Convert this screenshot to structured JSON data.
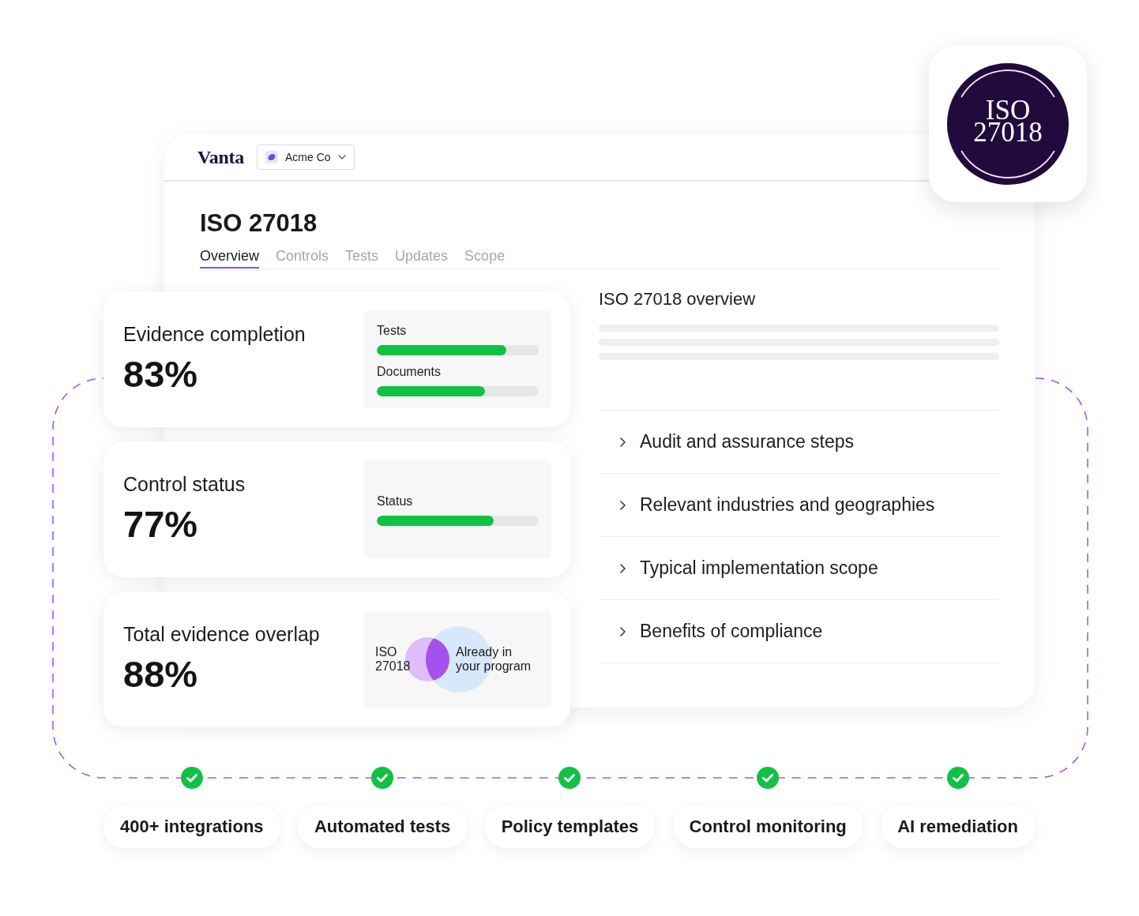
{
  "header": {
    "logo": "Vanta",
    "workspace": "Acme Co"
  },
  "badge": {
    "text": "ISO 27018"
  },
  "page": {
    "title": "ISO 27018",
    "tabs": [
      {
        "label": "Overview",
        "selected": true
      },
      {
        "label": "Controls",
        "selected": false
      },
      {
        "label": "Tests",
        "selected": false
      },
      {
        "label": "Updates",
        "selected": false
      },
      {
        "label": "Scope",
        "selected": false
      }
    ]
  },
  "cards": [
    {
      "kind": "bars",
      "title": "Evidence completion",
      "value": "83%",
      "bars": [
        {
          "label": "Tests",
          "level": 0.8
        },
        {
          "label": "Documents",
          "level": 0.67
        }
      ]
    },
    {
      "kind": "bars",
      "title": "Control status",
      "value": "77%",
      "bars": [
        {
          "label": "Status",
          "level": 0.72
        }
      ]
    },
    {
      "kind": "venn",
      "title": "Total evidence overlap",
      "value": "88%",
      "venn": {
        "left_label": "ISO 27018",
        "right_label": "Already in your program"
      }
    }
  ],
  "overview": {
    "title": "ISO 27018 overview",
    "sections": [
      "Audit and assurance steps",
      "Relevant industries and geographies",
      "Typical implementation scope",
      "Benefits of compliance"
    ]
  },
  "features": [
    {
      "label": "400+ integrations",
      "checked": true
    },
    {
      "label": "Automated tests",
      "checked": true
    },
    {
      "label": "Policy templates",
      "checked": true
    },
    {
      "label": "Control monitoring",
      "checked": true
    },
    {
      "label": "AI remediation",
      "checked": true
    }
  ]
}
